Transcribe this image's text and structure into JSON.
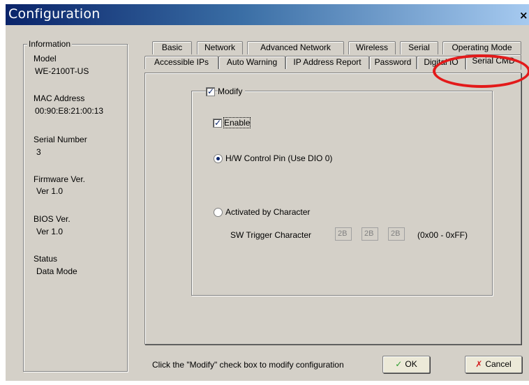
{
  "window": {
    "title": "Configuration",
    "close_label": "×"
  },
  "info": {
    "group_title": "Information",
    "model_label": "Model",
    "model_value": "WE-2100T-US",
    "mac_label": "MAC Address",
    "mac_value": "00:90:E8:21:00:13",
    "serial_label": "Serial Number",
    "serial_value": "3",
    "firmware_label": "Firmware Ver.",
    "firmware_value": "Ver 1.0",
    "bios_label": "BIOS Ver.",
    "bios_value": "Ver 1.0",
    "status_label": "Status",
    "status_value": "Data Mode"
  },
  "tabs": {
    "row1": [
      "Basic",
      "Network",
      "Advanced Network",
      "Wireless",
      "Serial",
      "Operating Mode"
    ],
    "row2": [
      "Accessible IPs",
      "Auto Warning",
      "IP Address Report",
      "Password",
      "Digital IO",
      "Serial CMD"
    ],
    "active": "Serial CMD"
  },
  "panel": {
    "modify_label": "Modify",
    "modify_checked": true,
    "enable_label": "Enable",
    "enable_checked": true,
    "hw_label": "H/W Control Pin (Use DIO 0)",
    "hw_selected": true,
    "char_label": "Activated by Character",
    "char_selected": false,
    "sw_trigger_label": "SW Trigger Character",
    "trigger_values": [
      "2B",
      "2B",
      "2B"
    ],
    "range_label": "(0x00 - 0xFF)"
  },
  "footer": {
    "hint": "Click the \"Modify\" check box to modify configuration",
    "ok_label": "OK",
    "cancel_label": "Cancel"
  },
  "icons": {
    "ok": "check-icon",
    "cancel": "x-icon",
    "annotation": "red-ellipse"
  },
  "colors": {
    "title_start": "#0a246a",
    "title_end": "#a6caf0",
    "annotation": "#e31a1a",
    "ok_check": "#2e9e2e",
    "cancel_x": "#d21a1a"
  }
}
